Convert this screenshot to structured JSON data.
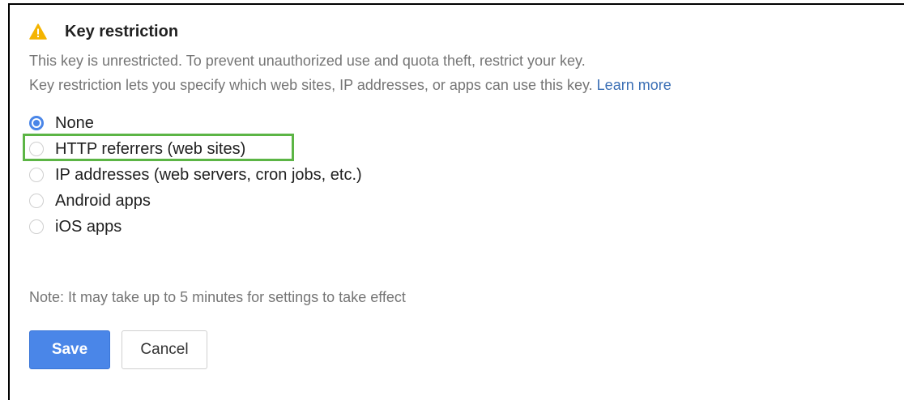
{
  "key_restriction": {
    "warning_icon": "warning-triangle-icon",
    "title": "Key restriction",
    "line1": "This key is unrestricted. To prevent unauthorized use and quota theft, restrict your key.",
    "line2": "Key restriction lets you specify which web sites, IP addresses, or apps can use this key.",
    "learn_more": "Learn more"
  },
  "options": [
    {
      "label": "None",
      "checked": true
    },
    {
      "label": "HTTP referrers (web sites)",
      "checked": false,
      "highlighted": true
    },
    {
      "label": "IP addresses (web servers, cron jobs, etc.)",
      "checked": false
    },
    {
      "label": "Android apps",
      "checked": false
    },
    {
      "label": "iOS apps",
      "checked": false
    }
  ],
  "note": "Note: It may take up to 5 minutes for settings to take effect",
  "buttons": {
    "save_label": "Save",
    "cancel_label": "Cancel"
  },
  "colors": {
    "accent": "#4a86e8",
    "warning": "#f4b400",
    "highlight": "#5cb545",
    "link": "#3b6fb5"
  }
}
